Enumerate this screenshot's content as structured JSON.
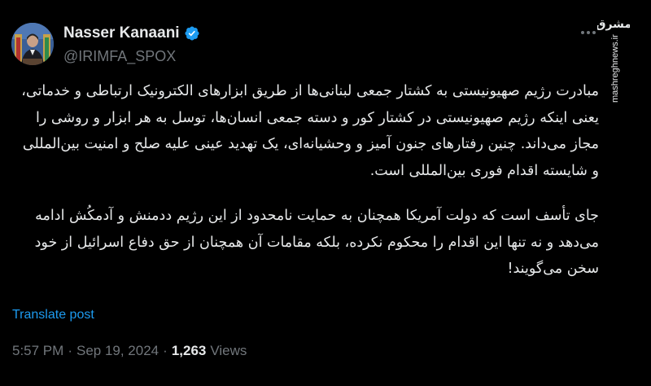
{
  "author": {
    "name": "Nasser Kanaani",
    "handle": "@IRIMFA_SPOX",
    "verified": true
  },
  "post": {
    "paragraphs": [
      "مبادرت رژیم صهیونیستی به کشتار جمعی لبنانی‌ها از طریق ابزارهای الکترونیک ارتباطی و خدماتی، یعنی اینکه رژیم صهیونیستی در کشتار کور و دسته جمعی انسان‌ها، توسل به هر ابزار و روشی را مجاز می‌داند. چنین رفتارهای جنون آمیز و وحشیانه‌ای، یک تهدید عینی علیه صلح و امنیت بین‌المللی و شایسته اقدام فوری بین‌المللی است.",
      "جای تأسف است که دولت آمریکا همچنان به حمایت نامحدود از این رژیم ددمنش و آدمکُش ادامه می‌دهد و نه تنها این اقدام را محکوم نکرده، بلکه مقامات آن همچنان از حق دفاع اسرائیل از خود سخن می‌گویند!"
    ],
    "translate_label": "Translate post",
    "time": "5:57 PM",
    "separator": "·",
    "date": "Sep 19, 2024",
    "views_count": "1,263",
    "views_label": "Views"
  },
  "watermark": {
    "logo_text": "مشرق",
    "site": "mashreghnews.ir"
  },
  "colors": {
    "background": "#000000",
    "text": "#e7e9ea",
    "muted": "#71767b",
    "accent": "#1d9bf0"
  },
  "icons": {
    "verified": "verified-badge-icon",
    "more": "more-options-icon"
  }
}
